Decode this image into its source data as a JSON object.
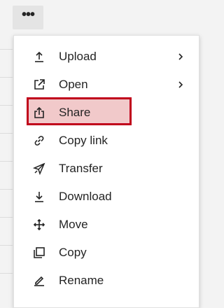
{
  "more_button": {
    "glyph": "•••"
  },
  "menu": {
    "items": [
      {
        "label": "Upload",
        "icon": "upload-icon",
        "has_submenu": true
      },
      {
        "label": "Open",
        "icon": "open-external-icon",
        "has_submenu": true
      },
      {
        "label": "Share",
        "icon": "share-icon",
        "has_submenu": false,
        "highlighted": true
      },
      {
        "label": "Copy link",
        "icon": "link-icon",
        "has_submenu": false
      },
      {
        "label": "Transfer",
        "icon": "send-icon",
        "has_submenu": false
      },
      {
        "label": "Download",
        "icon": "download-icon",
        "has_submenu": false
      },
      {
        "label": "Move",
        "icon": "move-icon",
        "has_submenu": false
      },
      {
        "label": "Copy",
        "icon": "copy-icon",
        "has_submenu": false
      },
      {
        "label": "Rename",
        "icon": "rename-icon",
        "has_submenu": false
      }
    ]
  },
  "colors": {
    "highlight_fill": "#f1c9ca",
    "highlight_border": "#c0001b",
    "text": "#242424"
  }
}
